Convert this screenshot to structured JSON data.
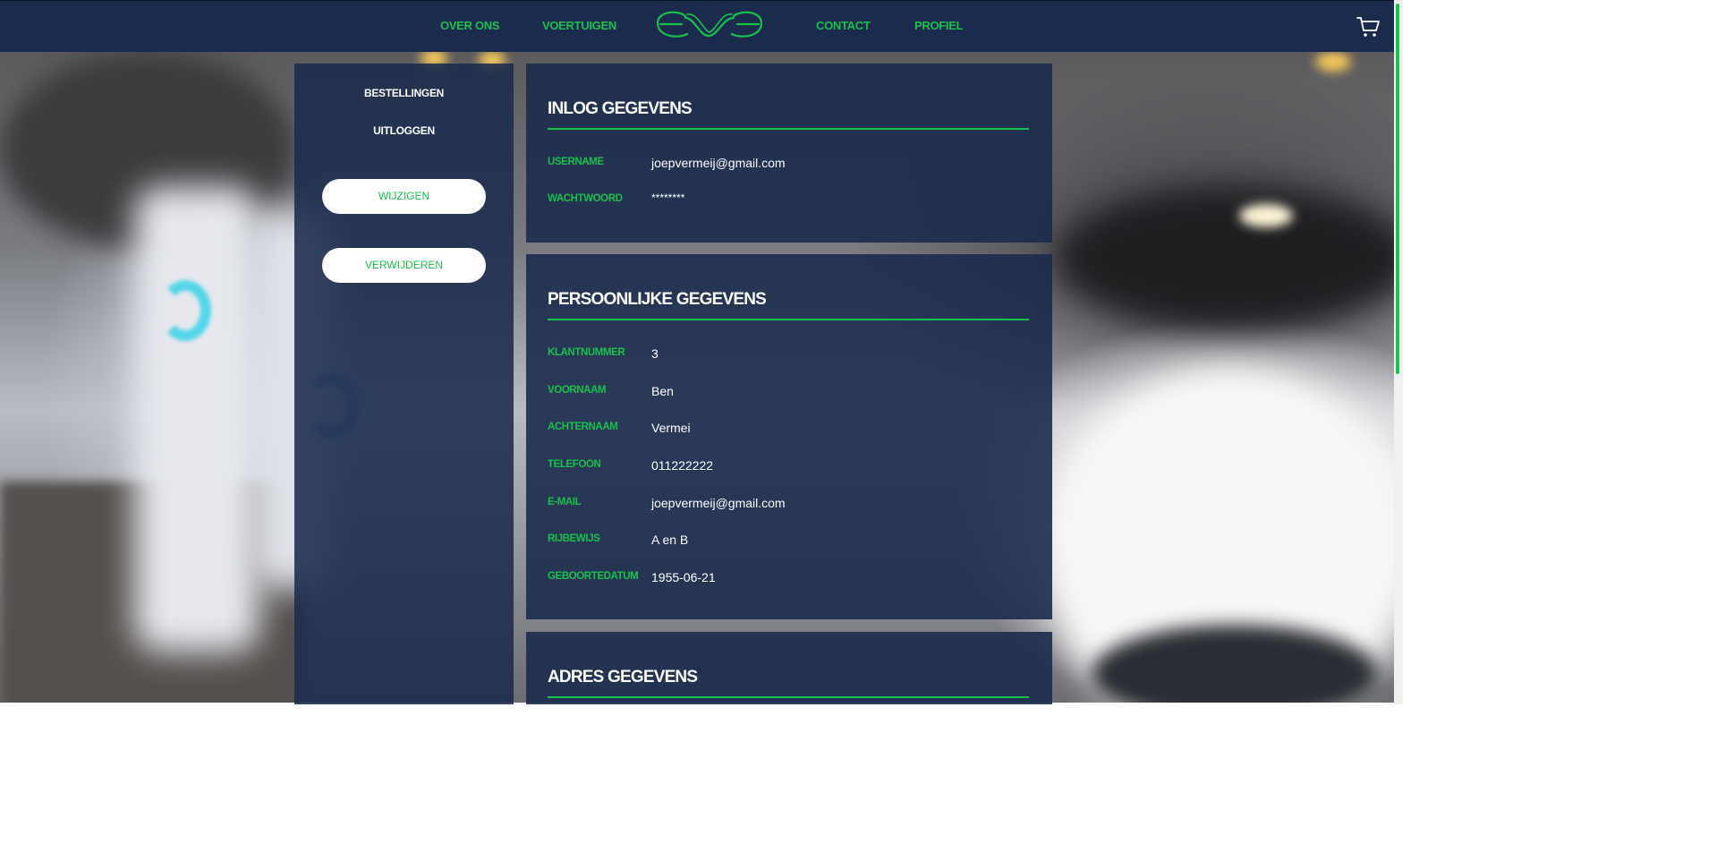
{
  "nav": {
    "left": [
      "OVER ONS",
      "VOERTUIGEN"
    ],
    "right": [
      "CONTACT",
      "PROFIEL"
    ],
    "logo_icon": "eve-logo",
    "cart_icon": "shopping-cart-icon"
  },
  "sidebar": {
    "links": [
      "BESTELLINGEN",
      "UITLOGGEN"
    ],
    "buttons": [
      "WIJZIGEN",
      "VERWIJDEREN"
    ]
  },
  "login": {
    "title": "INLOG GEGEVENS",
    "rows": [
      {
        "label": "USERNAME",
        "value": "joepvermeij@gmail.com"
      },
      {
        "label": "WACHTWOORD",
        "value": "********"
      }
    ]
  },
  "personal": {
    "title": "PERSOONLIJKE GEGEVENS",
    "rows": [
      {
        "label": "KLANTNUMMER",
        "value": "3"
      },
      {
        "label": "VOORNAAM",
        "value": "Ben"
      },
      {
        "label": "ACHTERNAAM",
        "value": "Vermei"
      },
      {
        "label": "TELEFOON",
        "value": "011222222"
      },
      {
        "label": "E-MAIL",
        "value": "joepvermeij@gmail.com"
      },
      {
        "label": "RIJBEWIJS",
        "value": "A en B"
      },
      {
        "label": "GEBOORTEDATUM",
        "value": "1955-06-21"
      }
    ]
  },
  "address": {
    "title": "ADRES GEGEVENS"
  },
  "colors": {
    "navy": "#1b2b4d",
    "accent_green": "#19c14a",
    "text_white": "#ffffff"
  }
}
